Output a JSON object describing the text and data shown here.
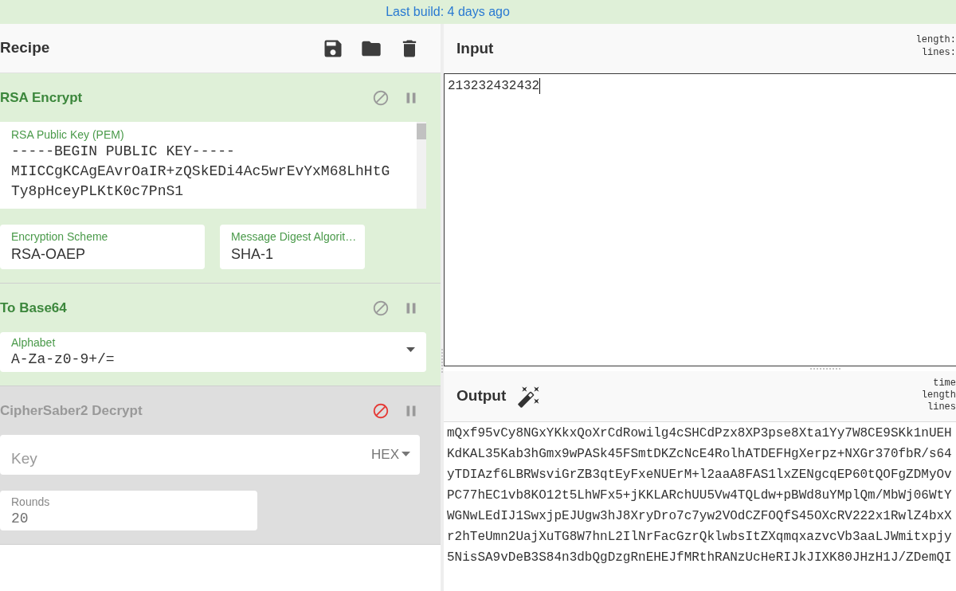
{
  "banner": {
    "text": "Last build: 4 days ago"
  },
  "recipe": {
    "title": "Recipe",
    "operations": [
      {
        "name": "RSA Encrypt",
        "disabled": false,
        "rows": [
          [
            {
              "kind": "textarea",
              "label": "RSA Public Key (PEM)",
              "lines": [
                "-----BEGIN PUBLIC KEY-----",
                "MIICCgKCAgEAvrOaIR+zQSkEDi4Ac5wrEvYxM68LhHtG",
                "Ty8pHceyPLKtK0c7PnS1"
              ]
            }
          ],
          [
            {
              "kind": "text",
              "label": "Encryption Scheme",
              "value": "RSA-OAEP"
            },
            {
              "kind": "text",
              "label": "Message Digest Algorit…",
              "value": "SHA-1"
            }
          ]
        ]
      },
      {
        "name": "To Base64",
        "disabled": false,
        "rows": [
          [
            {
              "kind": "select",
              "label": "Alphabet",
              "value": "A-Za-z0-9+/="
            }
          ]
        ]
      },
      {
        "name": "CipherSaber2 Decrypt",
        "disabled": true,
        "rows": [
          [
            {
              "kind": "toggle_string",
              "placeholder": "Key",
              "option": "HEX"
            }
          ],
          [
            {
              "kind": "number",
              "label": "Rounds",
              "value": "20"
            }
          ]
        ]
      }
    ]
  },
  "input": {
    "title": "Input",
    "stats": [
      "length:",
      "lines:"
    ],
    "value": "213232432432"
  },
  "output": {
    "title": "Output",
    "stats": [
      "time",
      "length",
      "lines"
    ],
    "lines": [
      "mQxf95vCy8NGxYKkxQoXrCdRowilg4cSHCdPzx8XP3pse8Xta1Yy7W8CE9SKk1nUEH",
      "KdKAL35Kab3hGmx9wPASk45FSmtDKZcNcE4RolhATDEFHgXerpz+NXGr370fbR/s64",
      "yTDIAzf6LBRWsviGrZB3qtEyFxeNUErM+l2aaA8FAS1lxZENgcqEP60tQOFgZDMyOv",
      "PC77hEC1vb8KO12t5LhWFx5+jKKLARchUU5Vw4TQLdw+pBWd8uYMplQm/MbWj06WtY",
      "WGNwLEdIJ1SwxjpEJUgw3hJ8XryDro7c7yw2VOdCZFOQfS45OXcRV222x1RwlZ4bxX",
      "r2hTeUmn2UajXuTG8W7hnL2IlNrFacGzrQklwbsItZXqmqxazvcVb3aaLJWmitxpjy",
      "5NisSA9vDeB3S84n3dbQgDzgRnEHEJfMRthRANzUcHeRIJkJIXK80JHzH1J/ZDemQI"
    ]
  }
}
